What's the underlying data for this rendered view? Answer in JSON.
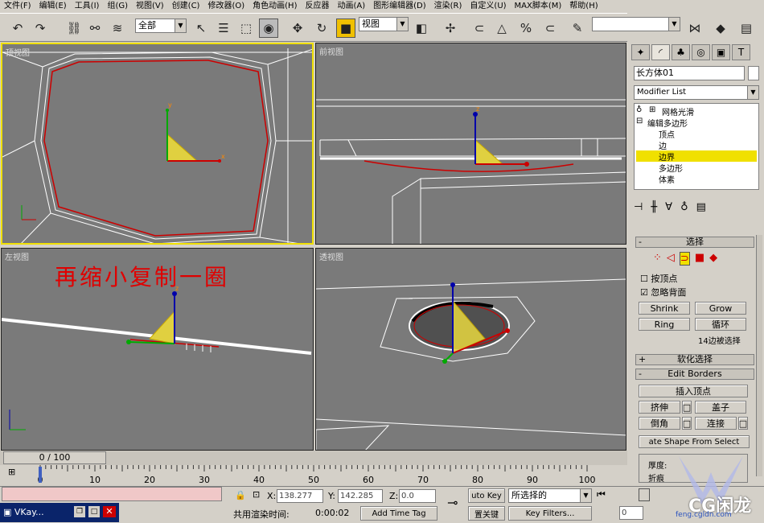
{
  "menu": [
    "文件(F)",
    "编辑(E)",
    "工具(I)",
    "组(G)",
    "视图(V)",
    "创建(C)",
    "修改器(O)",
    "角色动画(H)",
    "反应器",
    "动画(A)",
    "图形编辑器(D)",
    "渲染(R)",
    "自定义(U)",
    "MAX脚本(M)",
    "帮助(H)"
  ],
  "toolbar": {
    "selection_filter": "全部",
    "ref_coord": "视图"
  },
  "viewports": {
    "top": "顶视图",
    "front": "前视图",
    "left": "左视图",
    "persp": "透视图",
    "annotation": "再缩小复制一圈",
    "axis_x": "x",
    "axis_y": "y",
    "axis_z": "z"
  },
  "panel": {
    "object_name": "长方体01",
    "modifier_list": "Modifier List",
    "stack": {
      "mesh_smooth": "网格光滑",
      "edit_poly": "编辑多边形",
      "vertex": "顶点",
      "edge": "边",
      "border": "边界",
      "polygon": "多边形",
      "element": "体素"
    },
    "selection_title": "选择",
    "by_vertex": "按顶点",
    "ignore_backface": "忽略背面",
    "shrink": "Shrink",
    "grow": "Grow",
    "ring": "Ring",
    "loop": "循环",
    "selected_count": "14边被选择",
    "soft_selection": "软化选择",
    "edit_borders": "Edit Borders",
    "insert_vertex": "插入顶点",
    "extrude": "挤伸",
    "cap": "盖子",
    "chamfer": "倒角",
    "connect": "连接",
    "create_shape": "ate Shape From Select",
    "thickness": "厚度:",
    "fold": "折痕"
  },
  "timeline": {
    "frame": "0 / 100",
    "ticks": [
      "0",
      "10",
      "20",
      "30",
      "40",
      "50",
      "60",
      "70",
      "80",
      "90",
      "100"
    ]
  },
  "status": {
    "taskbar": "VKay...",
    "x_label": "X:",
    "x": "138.277",
    "y_label": "Y:",
    "y": "142.285",
    "z_label": "Z:",
    "z": "0.0",
    "auto_key": "uto Key",
    "set_key": "置关键",
    "selected": "所选择的",
    "key_filters": "Key Filters...",
    "render_time_label": "共用渲染时间:",
    "render_time": "0:00:02",
    "add_time_tag": "Add Time Tag",
    "frame_field": "0"
  },
  "watermark": {
    "text": "CG闲龙",
    "url": "feng.cgldn.com"
  }
}
